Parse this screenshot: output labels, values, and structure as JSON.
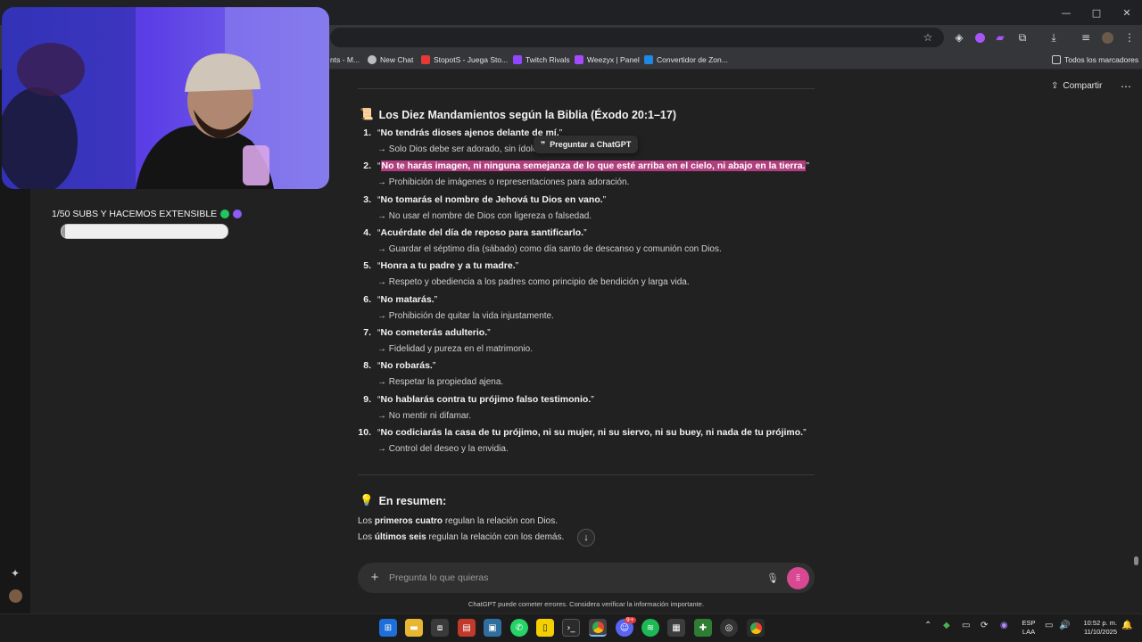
{
  "browser": {
    "window_controls": [
      "—",
      "□",
      "✕"
    ],
    "bookmarks": [
      {
        "label": "nts - M...",
        "color": "#5f6368"
      },
      {
        "label": "New Chat",
        "color": "#bdbdbd"
      },
      {
        "label": "StopotS - Juega Sto...",
        "color": "#e53935"
      },
      {
        "label": "Twitch Rivals",
        "color": "#9146ff"
      },
      {
        "label": "Weezyx | Panel",
        "color": "#a54bff"
      },
      {
        "label": "Convertidor de Zon...",
        "color": "#1e88e5"
      }
    ],
    "all_bookmarks": "Todos los marcadores"
  },
  "chat": {
    "share_label": "Compartir",
    "heading_emoji": "📜",
    "heading": "Los Diez Mandamientos según la Biblia (Éxodo 20:1–17)",
    "tooltip": "Preguntar a ChatGPT",
    "commandments": [
      {
        "num": "1.",
        "text": "No tendrás dioses ajenos delante de mí.",
        "explanation": "→ Solo Dios debe ser adorado, sin ídolos."
      },
      {
        "num": "2.",
        "text": "No te harás imagen, ni ninguna semejanza de lo que esté arriba en el cielo, ni abajo en la tierra.",
        "explanation": "→ Prohibición de imágenes o representaciones para adoración."
      },
      {
        "num": "3.",
        "text": "No tomarás el nombre de Jehová tu Dios en vano.",
        "explanation": "→ No usar el nombre de Dios con ligereza o falsedad."
      },
      {
        "num": "4.",
        "text": "Acuérdate del día de reposo para santificarlo.",
        "explanation": "→ Guardar el séptimo día (sábado) como día santo de descanso y comunión con Dios."
      },
      {
        "num": "5.",
        "text": "Honra a tu padre y a tu madre.",
        "explanation": "→ Respeto y obediencia a los padres como principio de bendición y larga vida."
      },
      {
        "num": "6.",
        "text": "No matarás.",
        "explanation": "→ Prohibición de quitar la vida injustamente."
      },
      {
        "num": "7.",
        "text": "No cometerás adulterio.",
        "explanation": "→ Fidelidad y pureza en el matrimonio."
      },
      {
        "num": "8.",
        "text": "No robarás.",
        "explanation": "→ Respetar la propiedad ajena."
      },
      {
        "num": "9.",
        "text": "No hablarás contra tu prójimo falso testimonio.",
        "explanation": "→ No mentir ni difamar."
      },
      {
        "num": "10.",
        "text": "No codiciarás la casa de tu prójimo, ni su mujer, ni su siervo, ni su buey, ni nada de tu prójimo.",
        "explanation": "→ Control del deseo y la envidia."
      }
    ],
    "summary": {
      "emoji": "💡",
      "heading": "En resumen:",
      "line1_pre": "Los ",
      "line1_bold": "primeros cuatro",
      "line1_post": " regulan la relación con Dios.",
      "line2_pre": "Los ",
      "line2_bold": "últimos seis",
      "line2_post": " regulan la relación con los demás."
    },
    "input_placeholder": "Pregunta lo que quieras",
    "disclaimer": "ChatGPT puede cometer errores. Considera verificar la información importante."
  },
  "stream_overlay": {
    "subs_goal": "1/50 SUBS Y HACEMOS EXTENSIBLE",
    "goal_progress": 0.02,
    "dot_colors": [
      "#22c55e",
      "#8b5cf6"
    ]
  },
  "taskbar": {
    "language_line1": "ESP",
    "language_line2": "LAA",
    "time": "10:52 p. m.",
    "date": "11/10/2025",
    "discord_badge": "9+"
  }
}
